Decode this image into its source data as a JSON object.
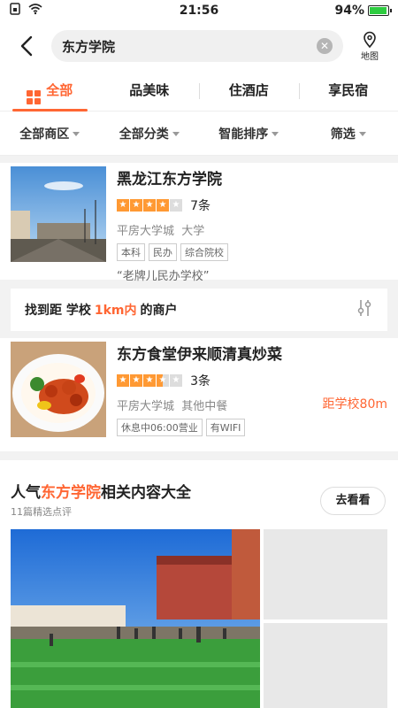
{
  "status": {
    "time": "21:56",
    "battery": "94%",
    "battery_level": 0.94
  },
  "search": {
    "query": "东方学院",
    "map_label": "地图"
  },
  "tabs": [
    {
      "label": "全部",
      "active": true
    },
    {
      "label": "品美味"
    },
    {
      "label": "住酒店"
    },
    {
      "label": "享民宿"
    }
  ],
  "filters": [
    "全部商区",
    "全部分类",
    "智能排序",
    "筛选"
  ],
  "shop1": {
    "name": "黑龙江东方学院",
    "rating": 4,
    "reviews": "7条",
    "location": "平房大学城",
    "category": "大学",
    "tags": [
      "本科",
      "民办",
      "综合院校"
    ],
    "quote": "“老牌儿民办学校”"
  },
  "nearby": {
    "prefix": "找到距 学校",
    "distance": "1km内",
    "suffix": "的商户"
  },
  "shop2": {
    "name": "东方食堂伊来顺清真炒菜",
    "rating": 3.5,
    "reviews": "3条",
    "location": "平房大学城",
    "category": "其他中餐",
    "tags": [
      "休息中06:00营业",
      "有WIFI"
    ],
    "distance": "距学校80m"
  },
  "section": {
    "title_prefix": "人气",
    "title_highlight": "东方学院",
    "title_suffix": "相关内容大全",
    "subtitle": "11篇精选点评",
    "button": "去看看"
  },
  "colors": {
    "accent": "#ff6633",
    "star": "#ff9933"
  }
}
